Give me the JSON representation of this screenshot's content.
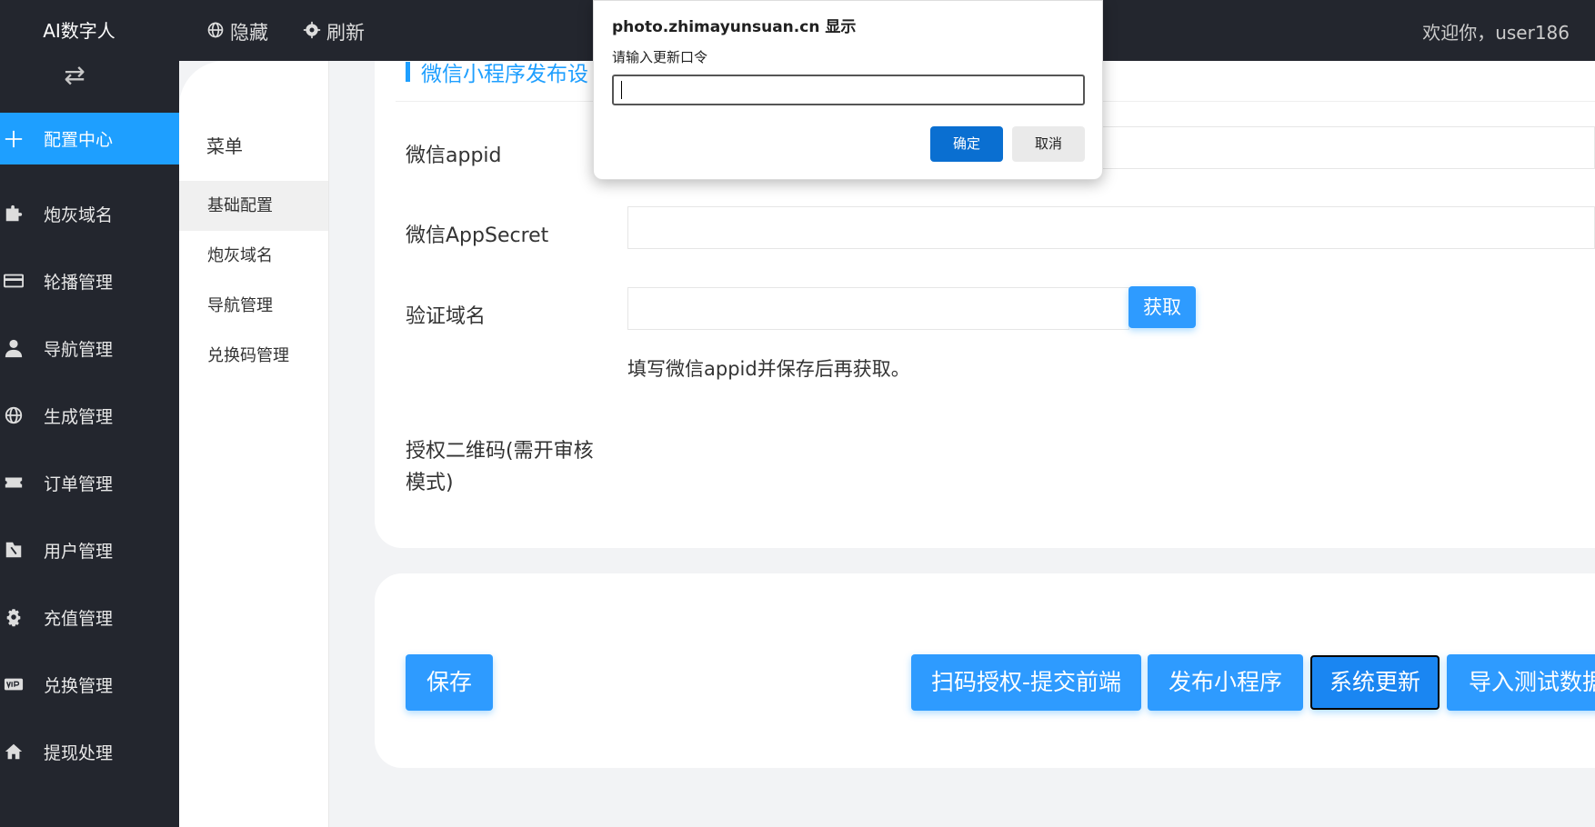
{
  "sidebar": {
    "logo": "AI数字人",
    "items": [
      {
        "label": "配置中心",
        "icon": "plus-icon"
      },
      {
        "label": "炮灰域名",
        "icon": "puzzle-icon"
      },
      {
        "label": "轮播管理",
        "icon": "card-icon"
      },
      {
        "label": "导航管理",
        "icon": "user-icon"
      },
      {
        "label": "生成管理",
        "icon": "globe-icon"
      },
      {
        "label": "订单管理",
        "icon": "ticket-icon"
      },
      {
        "label": "用户管理",
        "icon": "book-icon"
      },
      {
        "label": "充值管理",
        "icon": "gear-icon"
      },
      {
        "label": "兑换管理",
        "icon": "vip-icon"
      },
      {
        "label": "提现处理",
        "icon": "home-icon"
      }
    ]
  },
  "topbar": {
    "hide": "隐藏",
    "refresh": "刷新",
    "welcome": "欢迎你，user186"
  },
  "submenu": {
    "title": "菜单",
    "items": [
      "基础配置",
      "炮灰域名",
      "导航管理",
      "兑换码管理"
    ]
  },
  "form": {
    "section_title": "微信小程序发布设",
    "appid_label": "微信appid",
    "appsecret_label": "微信AppSecret",
    "domain_label": "验证域名",
    "get_button": "获取",
    "hint": "填写微信appid并保存后再获取。",
    "qrcode_label_1": "授权二维码(需开审核",
    "qrcode_label_2": "模式)"
  },
  "actions": {
    "save": "保存",
    "scan": "扫码授权-提交前端",
    "publish": "发布小程序",
    "update": "系统更新",
    "import": "导入测试数据"
  },
  "dialog": {
    "title": "photo.zhimayunsuan.cn 显示",
    "message": "请输入更新口令",
    "input_value": "",
    "ok": "确定",
    "cancel": "取消"
  },
  "colors": {
    "primary": "#1e9fff",
    "sidebar_bg": "#23262e",
    "dialog_ok": "#0a6fd1"
  }
}
